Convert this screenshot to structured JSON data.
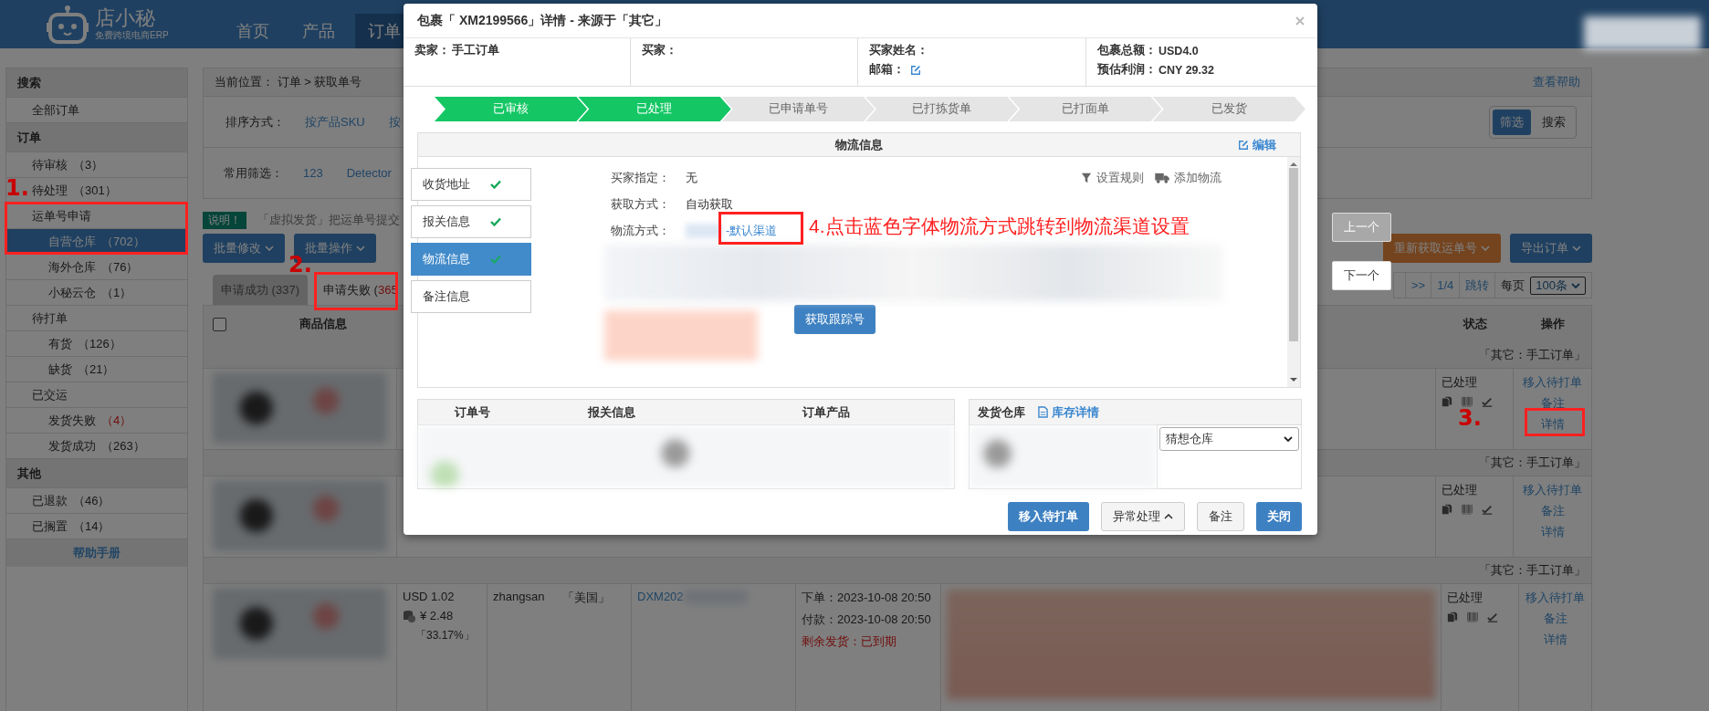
{
  "nav": {
    "logo": {
      "name": "店小秘",
      "tagline": "免费跨境电商ERP"
    },
    "items": [
      {
        "label": "首页",
        "selected": false
      },
      {
        "label": "产品",
        "selected": false
      },
      {
        "label": "订单",
        "selected": true
      }
    ]
  },
  "sidebar": {
    "sections": [
      {
        "title": "搜索",
        "items": [
          {
            "label": "全部订单",
            "selected": false
          }
        ]
      },
      {
        "title": "订单",
        "items": [
          {
            "label": "待审核",
            "count": "（3）",
            "selected": false
          },
          {
            "label": "待处理",
            "count": "（301）",
            "selected": false
          },
          {
            "label": "运单号申请",
            "selected": false,
            "children": [
              {
                "label": "自营仓库",
                "count": "（702）",
                "selected": true
              },
              {
                "label": "海外仓库",
                "count": "（76）",
                "selected": false
              },
              {
                "label": "小秘云仓",
                "count": "（1）",
                "selected": false
              }
            ]
          },
          {
            "label": "待打单",
            "selected": false,
            "children": [
              {
                "label": "有货",
                "count": "（126）",
                "selected": false
              },
              {
                "label": "缺货",
                "count": "（21）",
                "selected": false
              }
            ]
          },
          {
            "label": "已交运",
            "selected": false,
            "children": [
              {
                "label": "发货失败",
                "count": "（4）",
                "alert": true,
                "selected": false
              },
              {
                "label": "发货成功",
                "count": "（263）",
                "selected": false
              }
            ]
          }
        ]
      },
      {
        "title": "其他",
        "items": [
          {
            "label": "已退款",
            "count": "（46）",
            "selected": false
          },
          {
            "label": "已搁置",
            "count": "（14）",
            "selected": false
          }
        ]
      }
    ],
    "help": "帮助手册"
  },
  "breadcrumb": "当前位置：  订单 > 获取单号",
  "help_link": "查看帮助",
  "filters": {
    "sort": {
      "label": "排序方式：",
      "options": [
        "按产品SKU",
        "按"
      ]
    },
    "common": {
      "label": "常用筛选：",
      "options": [
        "123",
        "Detector"
      ]
    },
    "mode": [
      {
        "label": "筛选",
        "selected": true
      },
      {
        "label": "搜索",
        "selected": false
      }
    ]
  },
  "notice": {
    "badge": "说明！",
    "text": "「虚拟发货」把运单号提交"
  },
  "toolbar": {
    "left": [
      {
        "label": "批量修改",
        "kind": "primary"
      },
      {
        "label": "批量操作",
        "kind": "primary"
      }
    ],
    "right": [
      {
        "label": "重新获取运单号",
        "kind": "warning"
      },
      {
        "label": "导出订单",
        "kind": "primary"
      }
    ]
  },
  "tabs": [
    {
      "label": "申请成功 (337)",
      "selected": false
    },
    {
      "label": "申请失败 (",
      "count": "365",
      "selected": true
    }
  ],
  "pagination": {
    "next": ">>",
    "page": "1/4",
    "jump": "跳转",
    "per_page_label": "每页",
    "per_page": "100条"
  },
  "table": {
    "header_checkbox": {
      "checked": false
    },
    "columns": [
      "商品信息",
      "状态",
      "操作"
    ],
    "groups": [
      {
        "header": "「其它：手工订单」",
        "status": "已处理",
        "actions": [
          "移入待打单",
          "备注",
          "详情"
        ]
      },
      {
        "header": "「其它：手工订单」",
        "status": "已处理",
        "actions": [
          "移入待打单",
          "备注",
          "详情"
        ]
      },
      {
        "header": "「其它：手工订单」",
        "status": "已处理",
        "actions": [
          "移入待打单",
          "备注",
          "详情"
        ],
        "details": {
          "amount": "USD 1.02",
          "cost": "¥ 2.48",
          "margin": "「33.17%」",
          "buyer": "zhangsan",
          "country": "「美国」",
          "order_no": "DXM202",
          "ordered": "下单：2023-10-08 20:50",
          "paid": "付款：2023-10-08 20:50",
          "remaining": "剩余发货：已到期"
        }
      }
    ]
  },
  "dialog": {
    "title": "包裹「 XM2199566」详情 - 来源于「其它」",
    "info": [
      [
        {
          "label": "卖家：",
          "value": "手工订单"
        }
      ],
      [
        {
          "label": "买家："
        }
      ],
      [
        {
          "label": "买家姓名："
        },
        {
          "label": "邮箱：",
          "editable": true
        }
      ],
      [
        {
          "label": "包裹总额：",
          "value": "USD4.0"
        },
        {
          "label": "预估利润：",
          "value": "CNY 29.32"
        }
      ]
    ],
    "steps": [
      {
        "label": "已审核",
        "done": true
      },
      {
        "label": "已处理",
        "done": true
      },
      {
        "label": "已申请单号",
        "done": false
      },
      {
        "label": "已打拣货单",
        "done": false
      },
      {
        "label": "已打面单",
        "done": false
      },
      {
        "label": "已发货",
        "done": false
      }
    ],
    "logistics": {
      "title": "物流信息",
      "edit": "编辑",
      "side_tabs": [
        {
          "label": "收货地址",
          "done": true,
          "selected": false
        },
        {
          "label": "报关信息",
          "done": true,
          "selected": false
        },
        {
          "label": "物流信息",
          "done": true,
          "selected": true
        },
        {
          "label": "备注信息",
          "done": false,
          "selected": false
        }
      ],
      "fields": [
        {
          "label": "买家指定：",
          "value": "无"
        },
        {
          "label": "获取方式：",
          "value": "自动获取"
        },
        {
          "label": "物流方式：",
          "link": "-默认渠道"
        }
      ],
      "actions": [
        {
          "kind": "filter",
          "label": "设置规则"
        },
        {
          "kind": "truck",
          "label": "添加物流"
        }
      ],
      "track_button": "获取跟踪号"
    },
    "orders_table": {
      "columns": [
        "订单号",
        "报关信息",
        "订单产品"
      ]
    },
    "warehouse": {
      "title": "发货仓库",
      "link": "库存详情",
      "select": "猜想仓库"
    },
    "footer": [
      {
        "label": "移入待打单",
        "kind": "primary"
      },
      {
        "label": "异常处理",
        "kind": "dropdown"
      },
      {
        "label": "备注",
        "kind": "default"
      },
      {
        "label": "关闭",
        "kind": "primary"
      }
    ]
  },
  "nav_buttons": [
    {
      "label": "上一个",
      "disabled": true
    },
    {
      "label": "下一个",
      "disabled": false
    }
  ],
  "annotations": [
    "1.",
    "2.",
    "3.",
    "4.点击蓝色字体物流方式跳转到物流渠道设置"
  ]
}
